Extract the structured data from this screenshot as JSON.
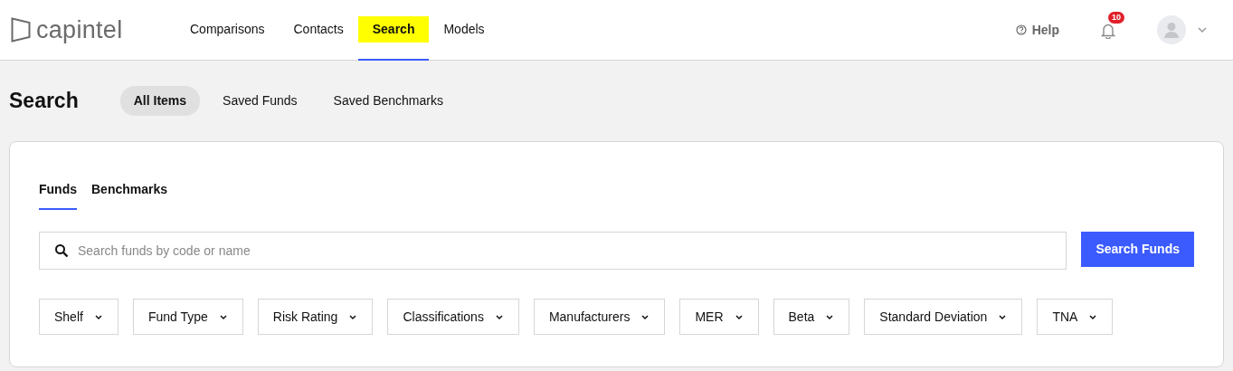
{
  "brand": "capintel",
  "nav": [
    {
      "label": "Comparisons",
      "selected": false,
      "highlighted": false
    },
    {
      "label": "Contacts",
      "selected": false,
      "highlighted": false
    },
    {
      "label": "Search",
      "selected": true,
      "highlighted": true
    },
    {
      "label": "Models",
      "selected": false,
      "highlighted": false
    }
  ],
  "help": "Help",
  "notifications": {
    "count": "10"
  },
  "page_title": "Search",
  "views": [
    {
      "label": "All Items",
      "selected": true
    },
    {
      "label": "Saved Funds",
      "selected": false
    },
    {
      "label": "Saved Benchmarks",
      "selected": false
    }
  ],
  "tabs": [
    {
      "label": "Funds",
      "selected": true
    },
    {
      "label": "Benchmarks",
      "selected": false
    }
  ],
  "search": {
    "placeholder": "Search funds by code or name",
    "button": "Search Funds"
  },
  "filters": [
    "Shelf",
    "Fund Type",
    "Risk Rating",
    "Classifications",
    "Manufacturers",
    "MER",
    "Beta",
    "Standard Deviation",
    "TNA"
  ]
}
